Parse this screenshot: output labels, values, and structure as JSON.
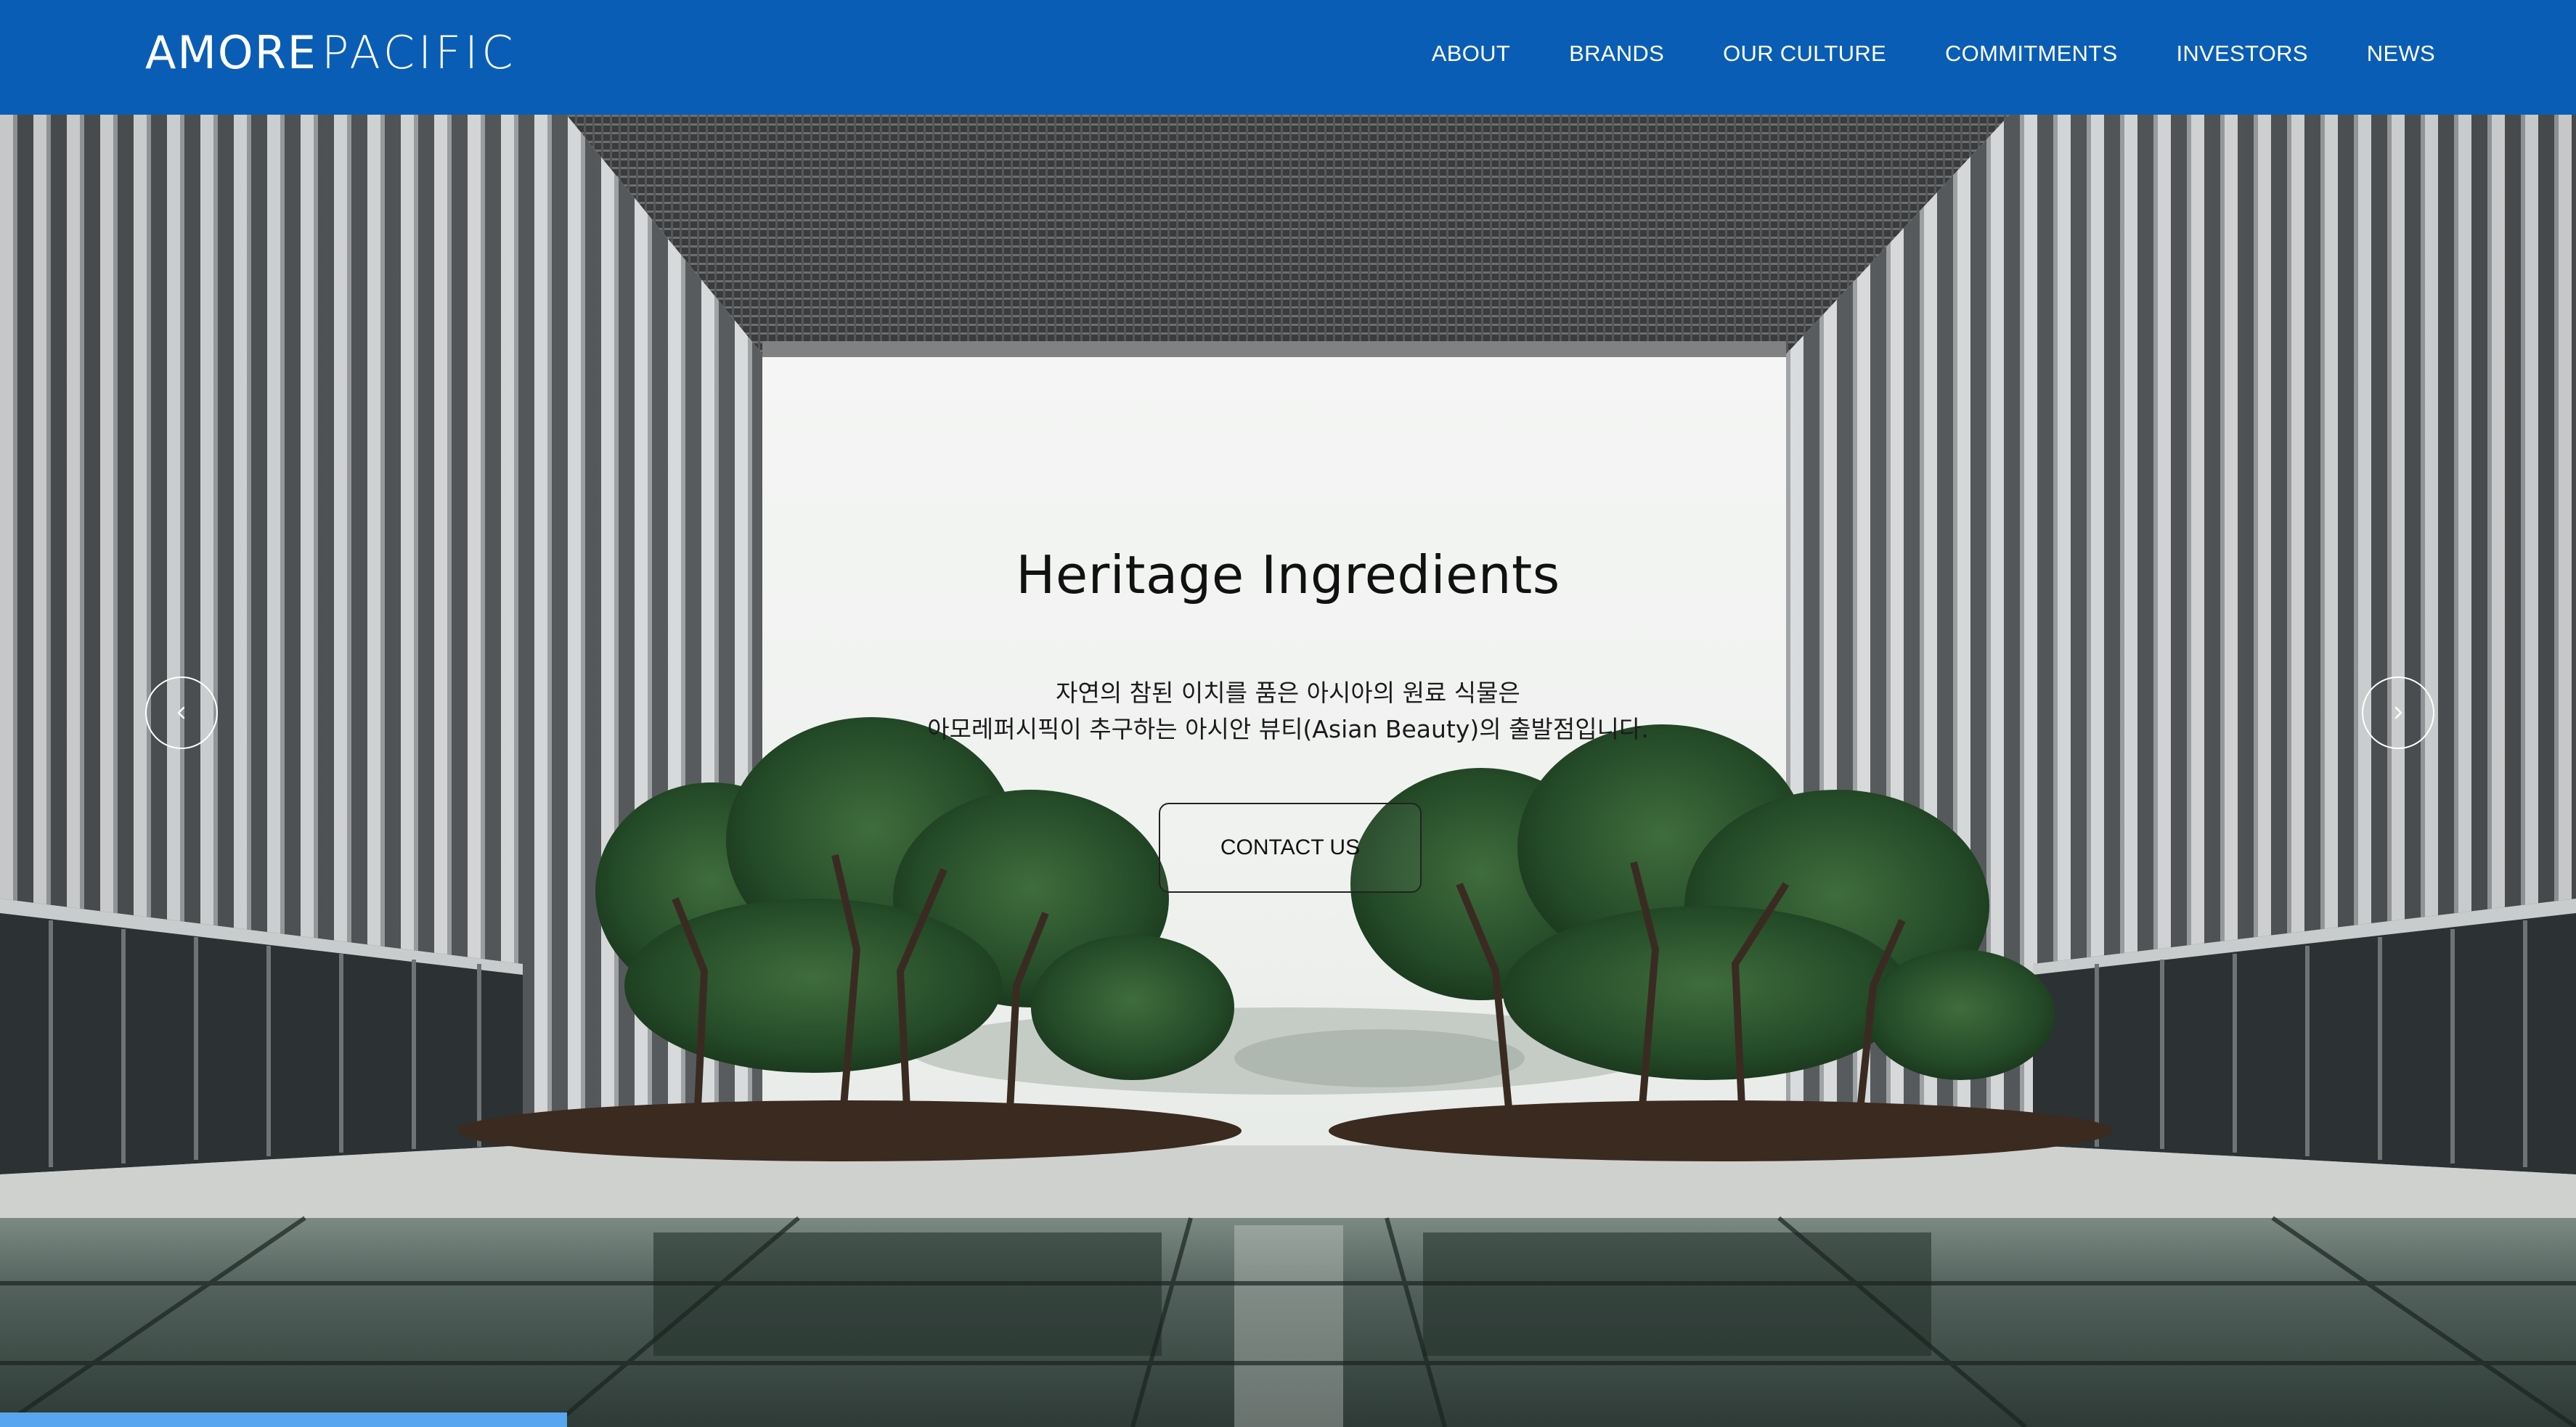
{
  "header": {
    "logo_part1": "AMORE",
    "logo_part2": "PACIFIC",
    "nav": [
      {
        "label": "ABOUT"
      },
      {
        "label": "BRANDS"
      },
      {
        "label": "OUR CULTURE"
      },
      {
        "label": "COMMITMENTS"
      },
      {
        "label": "INVESTORS"
      },
      {
        "label": "NEWS"
      }
    ]
  },
  "hero": {
    "title": "Heritage Ingredients",
    "description_line1": "자연의 참된 이치를 품은 아시아의 원료 식물은",
    "description_line2": "아모레퍼시픽이 추구하는 아시안 뷰티(Asian Beauty)의 출발점입니다.",
    "cta_label": "CONTACT US",
    "prev_icon": "chevron-left-icon",
    "next_icon": "chevron-right-icon",
    "slide_progress": 0.22
  },
  "colors": {
    "header_bg": "#0a5db4",
    "progress": "#58a6f0",
    "text_dark": "#111111"
  }
}
